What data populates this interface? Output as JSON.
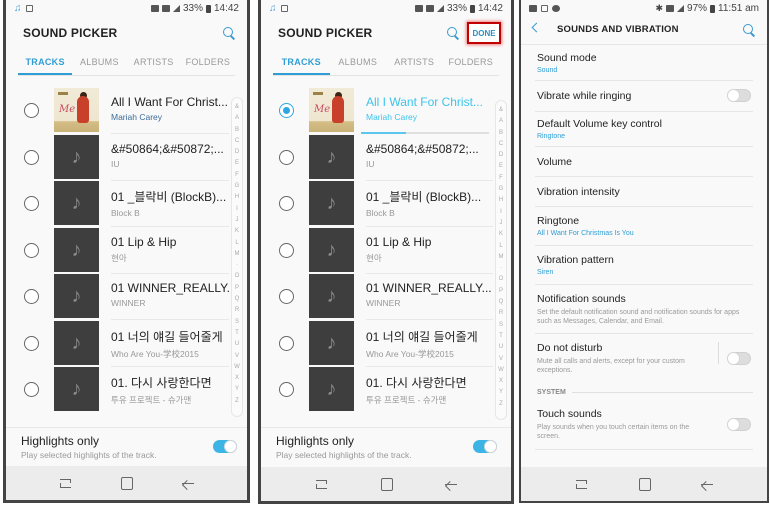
{
  "screens": [
    {
      "status": {
        "left_icons": [
          "music-note-icon",
          "checkbox-icon"
        ],
        "right_icons": [
          "mute-vibrate-icon",
          "alarm-icon",
          "data-icon",
          "signal-icon"
        ],
        "battery": "33%",
        "time": "14:42"
      },
      "title": "SOUND PICKER",
      "tabs": [
        "TRACKS",
        "ALBUMS",
        "ARTISTS",
        "FOLDERS"
      ],
      "active_tab": "TRACKS",
      "tracks": [
        {
          "title": "All I Want For Christ...",
          "artist": "Mariah Carey",
          "selected": false,
          "art": "album-cover"
        },
        {
          "title": "&#50864;&#50872;...",
          "artist": "IU",
          "selected": false,
          "art": "music-note"
        },
        {
          "title": "01 _블락비 (BlockB)...",
          "artist": "Block B",
          "selected": false,
          "art": "music-note"
        },
        {
          "title": "01 Lip & Hip",
          "artist": "현아",
          "selected": false,
          "art": "music-note"
        },
        {
          "title": "01 WINNER_REALLY...",
          "artist": "WINNER",
          "selected": false,
          "art": "music-note"
        },
        {
          "title": "01 너의 얘길 들어줄게",
          "artist": "Who Are You-学校2015",
          "selected": false,
          "art": "music-note"
        },
        {
          "title": "01. 다시 사랑한다면",
          "artist": "투유 프로젝트 - 슈가맨",
          "selected": false,
          "art": "music-note"
        }
      ],
      "alpha_index": [
        "&",
        "A",
        "B",
        "C",
        "D",
        "E",
        "F",
        "G",
        "H",
        "I",
        "J",
        "K",
        "L",
        "M",
        "·",
        "O",
        "P",
        "Q",
        "R",
        "S",
        "T",
        "U",
        "V",
        "W",
        "X",
        "Y",
        "Z"
      ],
      "highlights": {
        "label": "Highlights only",
        "description": "Play selected highlights of the track.",
        "enabled": true
      }
    },
    {
      "status": {
        "left_icons": [
          "music-note-icon",
          "checkbox-icon"
        ],
        "right_icons": [
          "mute-vibrate-icon",
          "alarm-icon",
          "data-icon",
          "signal-icon"
        ],
        "battery": "33%",
        "time": "14:42"
      },
      "title": "SOUND PICKER",
      "done_label": "DONE",
      "tabs": [
        "TRACKS",
        "ALBUMS",
        "ARTISTS",
        "FOLDERS"
      ],
      "active_tab": "TRACKS",
      "playback_progress": 0.35,
      "tracks": [
        {
          "title": "All I Want For Christ...",
          "artist": "Mariah Carey",
          "selected": true,
          "art": "album-cover"
        },
        {
          "title": "&#50864;&#50872;...",
          "artist": "IU",
          "selected": false,
          "art": "music-note"
        },
        {
          "title": "01 _블락비 (BlockB)...",
          "artist": "Block B",
          "selected": false,
          "art": "music-note"
        },
        {
          "title": "01 Lip & Hip",
          "artist": "현아",
          "selected": false,
          "art": "music-note"
        },
        {
          "title": "01 WINNER_REALLY...",
          "artist": "WINNER",
          "selected": false,
          "art": "music-note"
        },
        {
          "title": "01 너의 얘길 들어줄게",
          "artist": "Who Are You-学校2015",
          "selected": false,
          "art": "music-note"
        },
        {
          "title": "01. 다시 사랑한다면",
          "artist": "투유 프로젝트 - 슈가맨",
          "selected": false,
          "art": "music-note"
        }
      ],
      "alpha_index": [
        "&",
        "A",
        "B",
        "C",
        "D",
        "E",
        "F",
        "G",
        "H",
        "I",
        "J",
        "K",
        "L",
        "M",
        "·",
        "O",
        "P",
        "Q",
        "R",
        "S",
        "T",
        "U",
        "V",
        "W",
        "X",
        "Y",
        "Z"
      ],
      "highlights": {
        "label": "Highlights only",
        "description": "Play selected highlights of the track.",
        "enabled": true
      }
    },
    {
      "status": {
        "left_icons": [
          "gallery-icon",
          "email-icon",
          "message-icon"
        ],
        "right_icons": [
          "bluetooth-icon",
          "alarm-icon",
          "data-icon",
          "signal-icon"
        ],
        "battery": "97%",
        "time": "11:51 am"
      },
      "title": "SOUNDS AND VIBRATION",
      "items": [
        {
          "label": "Sound mode",
          "value": "Sound"
        },
        {
          "label": "Vibrate while ringing",
          "toggle": false
        },
        {
          "label": "Default Volume key control",
          "value": "Ringtone"
        },
        {
          "label": "Volume"
        },
        {
          "label": "Vibration intensity"
        },
        {
          "label": "Ringtone",
          "value": "All I Want For Christmas Is You"
        },
        {
          "label": "Vibration pattern",
          "value": "Siren"
        },
        {
          "label": "Notification sounds",
          "description": "Set the default notification sound and notification sounds for apps such as Messages, Calendar, and Email."
        },
        {
          "label": "Do not disturb",
          "description": "Mute all calls and alerts, except for your custom exceptions.",
          "toggle": false
        }
      ],
      "section": "SYSTEM",
      "system_items": [
        {
          "label": "Touch sounds",
          "description": "Play sounds when you touch certain items on the screen.",
          "toggle": false
        }
      ]
    }
  ],
  "colors": {
    "accent": "#2f9ed6",
    "selected_text": "#3cc4ec",
    "toggle_on": "#3cb5e6",
    "highlight_border": "#c10000"
  }
}
